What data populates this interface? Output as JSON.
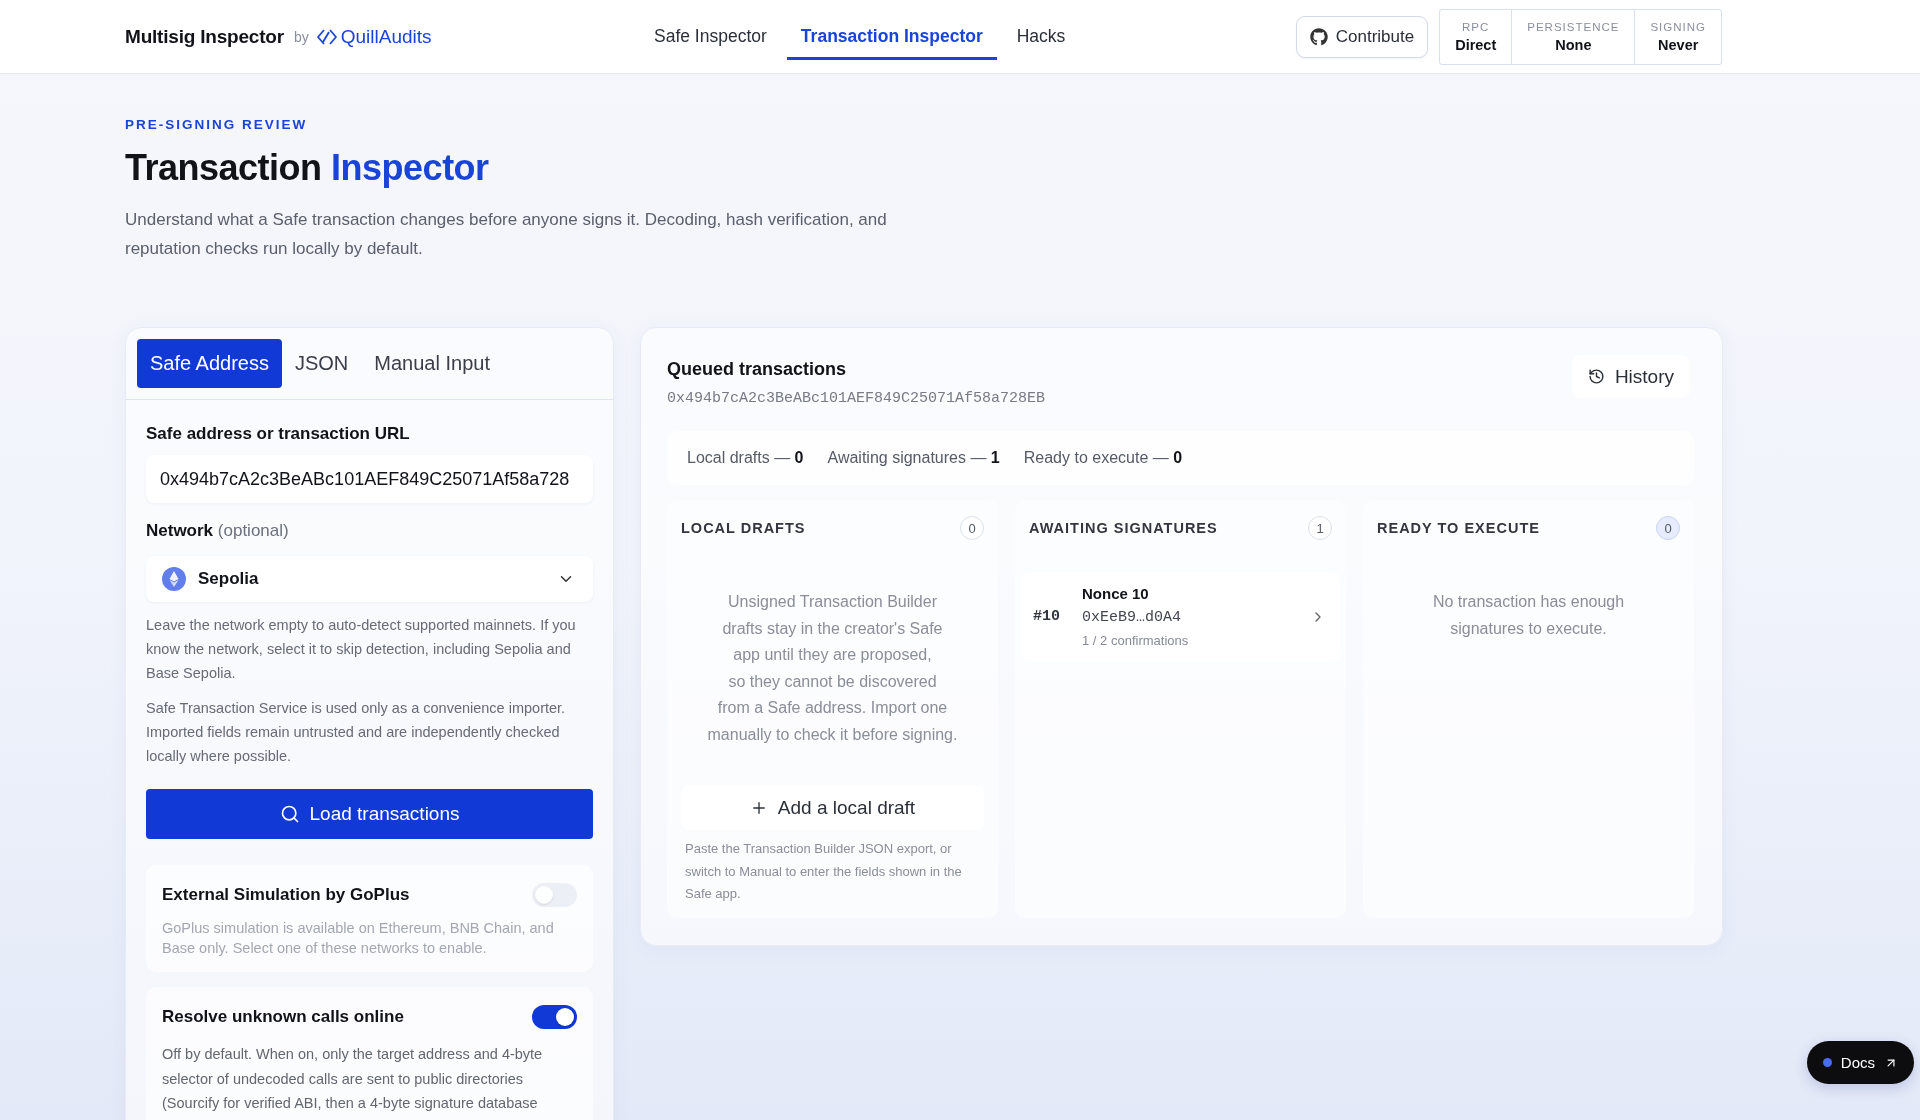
{
  "header": {
    "app_name": "Multisig Inspector",
    "by_label": "by",
    "brand": "QuillAudits",
    "nav": [
      {
        "label": "Safe Inspector",
        "selected": false
      },
      {
        "label": "Transaction Inspector",
        "selected": true
      },
      {
        "label": "Hacks",
        "selected": false
      }
    ],
    "contribute_button": "Contribute",
    "status": [
      {
        "label": "RPC",
        "value": "Direct"
      },
      {
        "label": "PERSISTENCE",
        "value": "None"
      },
      {
        "label": "SIGNING",
        "value": "Never"
      }
    ]
  },
  "hero": {
    "eyebrow": "PRE-SIGNING REVIEW",
    "title": "Transaction",
    "title_highlight": "Inspector",
    "description": "Understand what a Safe transaction changes before anyone signs it. Decoding, hash verification, and reputation checks run locally by default."
  },
  "input_panel": {
    "tabs": [
      {
        "label": "Safe Address",
        "selected": true
      },
      {
        "label": "JSON",
        "selected": false
      },
      {
        "label": "Manual Input",
        "selected": false
      }
    ],
    "address_field": {
      "label": "Safe address or transaction URL",
      "value": "0x494b7cA2c3BeABc101AEF849C25071Af58a728"
    },
    "network_field": {
      "label": "Network",
      "label_note": "(optional)",
      "value": "Sepolia"
    },
    "help_texts": [
      "Leave the network empty to auto-detect supported mainnets. If you know the network, select it to skip detection, including Sepolia and Base Sepolia.",
      "Safe Transaction Service is used only as a convenience importer. Imported fields remain untrusted and are independently checked locally where possible."
    ],
    "load_button": "Load transactions",
    "toggles": [
      {
        "title": "External Simulation by GoPlus",
        "description": "GoPlus simulation is available on Ethereum, BNB Chain, and Base only. Select one of these networks to enable.",
        "on": false,
        "disabled": true
      },
      {
        "title": "Resolve unknown calls online",
        "description": "Off by default. When on, only the target address and 4-byte selector of undecoded calls are sent to public directories (Sourcify for verified ABI, then a 4-byte signature database",
        "on": true,
        "disabled": false
      }
    ]
  },
  "queue_panel": {
    "title": "Queued transactions",
    "address": "0x494b7cA2c3BeABc101AEF849C25071Af58a728EB",
    "history_button": "History",
    "summary": [
      "Local drafts — **0**",
      "Awaiting signatures — **1**",
      "Ready to execute — **0**"
    ],
    "columns": [
      {
        "kind": "drafts",
        "title": "LOCAL DRAFTS",
        "count": "0",
        "empty_text": "Unsigned Transaction Builder drafts stay in the creator's Safe app until they are proposed, so they cannot be discovered from a Safe address. Import one manually to check it before signing.",
        "add_button": "Add a local draft",
        "add_hint": "Paste the Transaction Builder JSON export, or switch to Manual to enter the fields shown in the Safe app."
      },
      {
        "kind": "awaiting",
        "title": "AWAITING SIGNATURES",
        "count": "1",
        "transactions": [
          {
            "number": "#10",
            "nonce": "Nonce 10",
            "to": "0xEeB9…d0A4",
            "confirmations": "1 / 2 confirmations"
          }
        ]
      },
      {
        "kind": "ready",
        "title": "READY TO EXECUTE",
        "count": "0",
        "empty_text": "No transaction has enough signatures to execute."
      }
    ]
  },
  "docs_button": "Docs"
}
